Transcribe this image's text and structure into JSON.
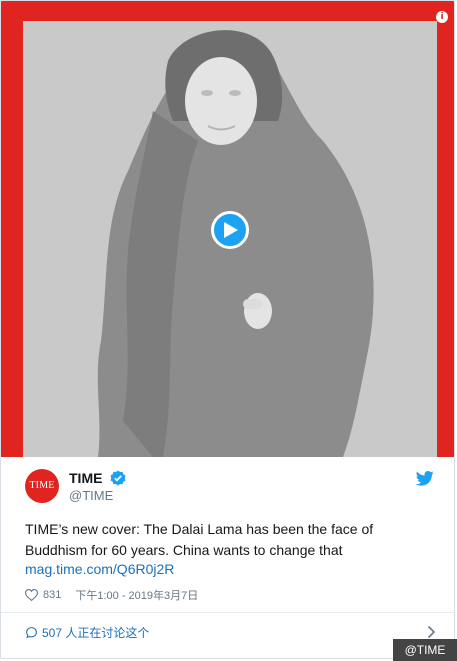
{
  "tweet": {
    "author_name": "TIME",
    "handle": "@TIME",
    "avatar_text": "TIME",
    "text": "TIME’s new cover: The Dalai Lama has been the face of Buddhism for 60 years. China wants to change that",
    "link": "mag.time.com/Q6R0j2R",
    "likes": "831",
    "timestamp": "下午1:00 - 2019年3月7日",
    "discussion": "507 人正在讨论这个"
  },
  "watermark": "@TIME",
  "icons": {
    "info": "info-icon",
    "play": "play-icon",
    "verified": "verified-badge-icon",
    "bird": "twitter-bird-icon",
    "heart": "heart-icon",
    "comment": "comment-bubble-icon",
    "chevron": "chevron-right-icon"
  },
  "colors": {
    "brand_red": "#e0241f",
    "twitter_blue": "#1da1f2",
    "link_blue": "#1b6fbd"
  }
}
